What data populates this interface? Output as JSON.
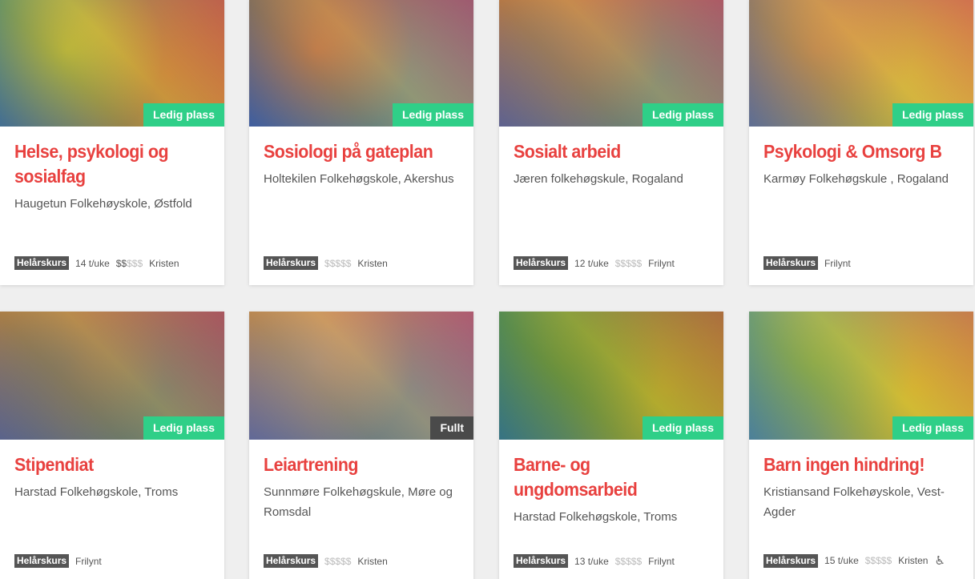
{
  "cards": [
    {
      "title_lines": [
        "Helse, psykologi og",
        "sosialfag"
      ],
      "school_lines": [
        "Haugetun Folkehøyskole, Østfold"
      ],
      "status": "Ledig plass",
      "type": "Helårskurs",
      "hours": "14 t/uke",
      "price_on": "$$",
      "price_off": "$$$",
      "profile": "Kristen",
      "photo_colors": [
        "#3c7a8c",
        "#c9b23f",
        "#b5604a"
      ]
    },
    {
      "title_lines": [
        "Sosiologi på gateplan"
      ],
      "school_lines": [
        "Holtekilen Folkehøgskole, Akershus"
      ],
      "status": "Ledig plass",
      "type": "Helårskurs",
      "hours": "",
      "price_on": "",
      "price_off": "$$$$$",
      "profile": "Kristen",
      "photo_colors": [
        "#6a3a7a",
        "#d44e5c",
        "#4867b8"
      ]
    },
    {
      "title_lines": [
        "Sosialt arbeid"
      ],
      "school_lines": [
        "Jæren folkehøgskule, Rogaland"
      ],
      "status": "Ledig plass",
      "type": "Helårskurs",
      "hours": "12 t/uke",
      "price_on": "",
      "price_off": "$$$$$",
      "profile": "Frilynt",
      "photo_colors": [
        "#d84c4a",
        "#a0527a",
        "#3e5fb0"
      ]
    },
    {
      "title_lines": [
        "Psykologi & Omsorg B"
      ],
      "school_lines": [
        "Karmøy Folkehøgskule , Rogaland"
      ],
      "status": "Ledig plass",
      "type": "Helårskurs",
      "hours": "",
      "price_on": "",
      "price_off": "",
      "profile": "Frilynt",
      "photo_colors": [
        "#8a4f8e",
        "#d96a64",
        "#c9a14f"
      ]
    },
    {
      "title_lines": [
        "Stipendiat"
      ],
      "school_lines": [
        "Harstad Folkehøgskole, Troms"
      ],
      "status": "Ledig plass",
      "type": "Helårskurs",
      "hours": "",
      "price_on": "",
      "price_off": "",
      "profile": "Frilynt",
      "photo_colors": [
        "#c9594a",
        "#7a4d7a",
        "#3a4f9a"
      ]
    },
    {
      "title_lines": [
        "Leiartrening"
      ],
      "school_lines": [
        "Sunnmøre Folkehøgskule, Møre og",
        "Romsdal"
      ],
      "status": "Fullt",
      "type": "Helårskurs",
      "hours": "",
      "price_on": "",
      "price_off": "$$$$$",
      "profile": "Kristen",
      "photo_colors": [
        "#e0675a",
        "#b071a8",
        "#4058c8"
      ]
    },
    {
      "title_lines": [
        "Barne- og",
        "ungdomsarbeid"
      ],
      "school_lines": [
        "Harstad Folkehøgskole, Troms"
      ],
      "status": "Ledig plass",
      "type": "Helårskurs",
      "hours": "13 t/uke",
      "price_on": "",
      "price_off": "$$$$$",
      "profile": "Frilynt",
      "photo_colors": [
        "#1f6f6a",
        "#4d7a3c",
        "#8d8a30"
      ]
    },
    {
      "title_lines": [
        "Barn ingen hindring!"
      ],
      "school_lines": [
        "Kristiansand Folkehøyskole, Vest-",
        "Agder"
      ],
      "status": "Ledig plass",
      "type": "Helårskurs",
      "hours": "15 t/uke",
      "price_on": "",
      "price_off": "$$$$$",
      "profile": "Kristen",
      "accessible_icon": "wheelchair-icon",
      "photo_colors": [
        "#4a8bb0",
        "#7fa25a",
        "#c6a838"
      ]
    }
  ],
  "colors": {
    "title": "#e8413f",
    "ledig": "#2fcf88",
    "fullt": "#4a4a4a",
    "type_badge": "#555555"
  }
}
